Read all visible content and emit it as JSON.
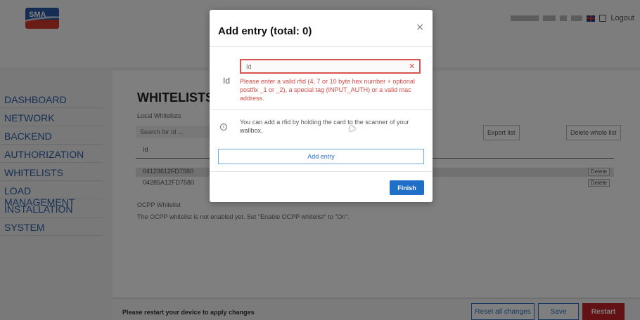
{
  "brand": {
    "logo_text": "SMA"
  },
  "header": {
    "logout_label": "Logout"
  },
  "sidebar": {
    "items": [
      {
        "label": "DASHBOARD"
      },
      {
        "label": "NETWORK"
      },
      {
        "label": "BACKEND"
      },
      {
        "label": "AUTHORIZATION"
      },
      {
        "label": "WHITELISTS"
      },
      {
        "label": "LOAD MANAGEMENT"
      },
      {
        "label": "INSTALLATION"
      },
      {
        "label": "SYSTEM"
      }
    ]
  },
  "main": {
    "title": "WHITELISTS",
    "local_label": "Local Whitelists",
    "search_placeholder": "Search for Id ...",
    "export_label": "Export list",
    "delete_all_label": "Delete whole list",
    "column_id": "Id",
    "rows": [
      {
        "id": "04123612FD7580",
        "delete_label": "Delete"
      },
      {
        "id": "04285A12FD7580",
        "delete_label": "Delete"
      }
    ],
    "ocpp_label": "OCPP Whitelist",
    "ocpp_note": "The OCPP whitelist is not enabled yet. Set \"Enable OCPP whitelist\" to \"On\"."
  },
  "footer": {
    "message": "Please restart your device to apply changes",
    "reset_label": "Reset all changes",
    "save_label": "Save",
    "restart_label": "Restart"
  },
  "modal": {
    "title": "Add entry (total: 0)",
    "close_glyph": "×",
    "id_label": "Id",
    "id_placeholder": "Id",
    "clear_glyph": "✕",
    "error_text": "Please enter a valid rfid (4, 7 or 10 byte hex number + optional postfix _1 or _2), a special tag (INPUT_AUTH) or a valid mac address.",
    "info_glyph": "i",
    "info_text": "You can add a rfid by holding the card to the scanner of your wallbox.",
    "add_entry_label": "Add entry",
    "finish_label": "Finish"
  },
  "icons": {
    "logout": "logout-icon",
    "info": "info-icon",
    "close": "close-icon",
    "flag": "uk-flag-icon"
  },
  "colors": {
    "nav_blue": "#2a5fa8",
    "error_red": "#d9534f",
    "primary_blue": "#1f6ec7",
    "restart_red": "#c7232b"
  }
}
